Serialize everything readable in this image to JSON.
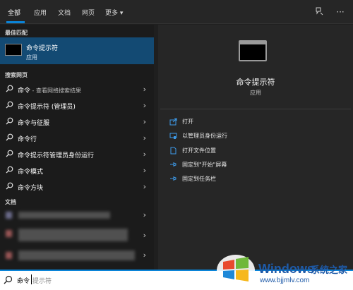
{
  "tabs": [
    {
      "label": "全部",
      "active": true
    },
    {
      "label": "应用"
    },
    {
      "label": "文档"
    },
    {
      "label": "网页"
    },
    {
      "label": "更多 ▾"
    }
  ],
  "top_icons": [
    "feedback-icon",
    "more-options-icon"
  ],
  "left": {
    "best_match_header": "最佳匹配",
    "best_match": {
      "title": "命令提示符",
      "subtitle": "应用"
    },
    "web_header": "搜索网页",
    "web_results": [
      {
        "label": "命令",
        "hint": " - 查看网络搜索结果"
      },
      {
        "label": "命令提示符 (管理员)",
        "hint": ""
      },
      {
        "label": "命令与征服",
        "hint": ""
      },
      {
        "label": "命令行",
        "hint": ""
      },
      {
        "label": "命令提示符管理员身份运行",
        "hint": ""
      },
      {
        "label": "命令模式",
        "hint": ""
      },
      {
        "label": "命令方块",
        "hint": ""
      }
    ],
    "docs_header": "文档"
  },
  "right": {
    "app_title": "命令提示符",
    "app_subtitle": "应用",
    "actions": [
      {
        "label": "打开",
        "icon": "open-icon"
      },
      {
        "label": "以管理员身份运行",
        "icon": "run-as-admin-icon"
      },
      {
        "label": "打开文件位置",
        "icon": "file-location-icon"
      },
      {
        "label": "固定到\"开始\"屏幕",
        "icon": "pin-icon"
      },
      {
        "label": "固定到任务栏",
        "icon": "pin-icon"
      }
    ]
  },
  "search": {
    "typed": "命令",
    "suggestion": "提示符"
  },
  "watermark": {
    "brand": "Windows",
    "cn": "系统之家",
    "url": "www.bjjmlv.com"
  },
  "colors": {
    "accent": "#0a84d8",
    "selected": "#134a73",
    "panel_left": "#1b1b1b",
    "panel_right": "#262626"
  }
}
